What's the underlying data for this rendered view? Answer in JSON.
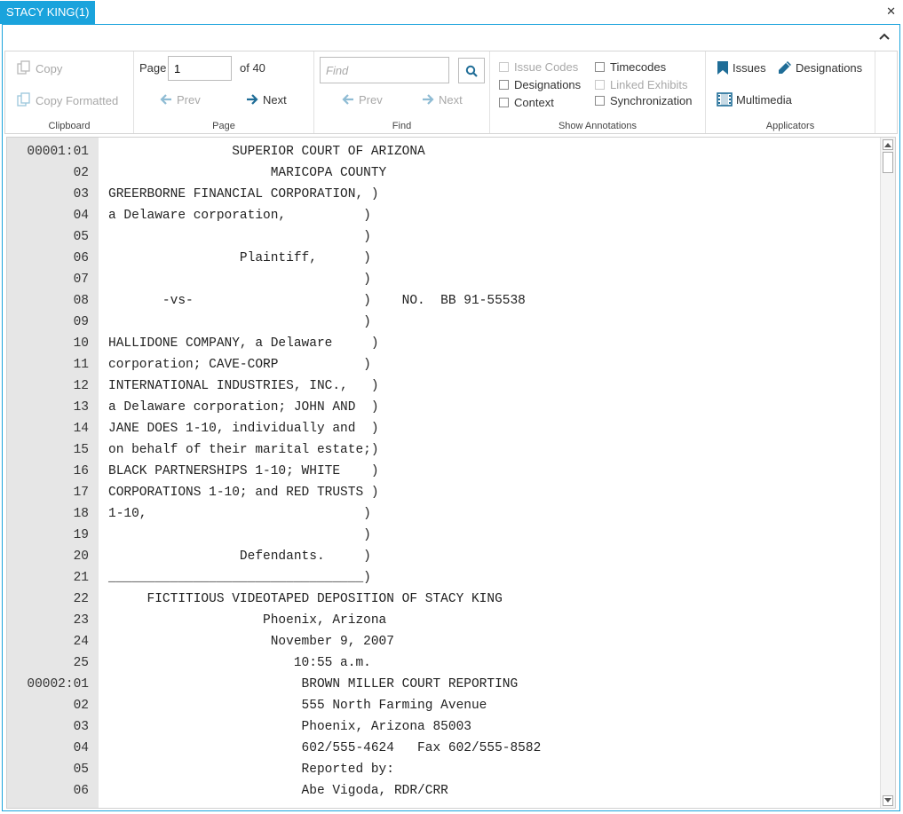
{
  "tab": {
    "title": "STACY KING(1)"
  },
  "ribbon": {
    "clipboard": {
      "copy": "Copy",
      "copy_formatted": "Copy Formatted",
      "label": "Clipboard"
    },
    "page": {
      "label_page": "Page",
      "current": "1",
      "of_total": "of 40",
      "prev": "Prev",
      "next": "Next",
      "label": "Page"
    },
    "find": {
      "placeholder": "Find",
      "prev": "Prev",
      "next": "Next",
      "label": "Find"
    },
    "annotations": {
      "issue_codes": "Issue Codes",
      "designations": "Designations",
      "context": "Context",
      "timecodes": "Timecodes",
      "linked_exhibits": "Linked Exhibits",
      "synchronization": "Synchronization",
      "label": "Show Annotations"
    },
    "applicators": {
      "issues": "Issues",
      "designations": "Designations",
      "multimedia": "Multimedia",
      "label": "Applicators"
    }
  },
  "colors": {
    "accent": "#1aa3dc",
    "icon_blue": "#1f6d97",
    "disabled": "#a8a8a8"
  },
  "transcript": [
    {
      "num": "00001:01",
      "text": "                SUPERIOR COURT OF ARIZONA"
    },
    {
      "num": "02",
      "text": "                     MARICOPA COUNTY"
    },
    {
      "num": "03",
      "text": "GREERBORNE FINANCIAL CORPORATION, )"
    },
    {
      "num": "04",
      "text": "a Delaware corporation,          )"
    },
    {
      "num": "05",
      "text": "                                 )"
    },
    {
      "num": "06",
      "text": "                 Plaintiff,      )"
    },
    {
      "num": "07",
      "text": "                                 )"
    },
    {
      "num": "08",
      "text": "       -vs-                      )    NO.  BB 91-55538"
    },
    {
      "num": "09",
      "text": "                                 )"
    },
    {
      "num": "10",
      "text": "HALLIDONE COMPANY, a Delaware     )"
    },
    {
      "num": "11",
      "text": "corporation; CAVE-CORP           )"
    },
    {
      "num": "12",
      "text": "INTERNATIONAL INDUSTRIES, INC.,   )"
    },
    {
      "num": "13",
      "text": "a Delaware corporation; JOHN AND  )"
    },
    {
      "num": "14",
      "text": "JANE DOES 1-10, individually and  )"
    },
    {
      "num": "15",
      "text": "on behalf of their marital estate;)"
    },
    {
      "num": "16",
      "text": "BLACK PARTNERSHIPS 1-10; WHITE    )"
    },
    {
      "num": "17",
      "text": "CORPORATIONS 1-10; and RED TRUSTS )"
    },
    {
      "num": "18",
      "text": "1-10,                            )"
    },
    {
      "num": "19",
      "text": "                                 )"
    },
    {
      "num": "20",
      "text": "                 Defendants.     )"
    },
    {
      "num": "21",
      "text": "_________________________________)"
    },
    {
      "num": "22",
      "text": "     FICTITIOUS VIDEOTAPED DEPOSITION OF STACY KING"
    },
    {
      "num": "23",
      "text": "                    Phoenix, Arizona"
    },
    {
      "num": "24",
      "text": "                     November 9, 2007"
    },
    {
      "num": "25",
      "text": "                        10:55 a.m."
    },
    {
      "num": "00002:01",
      "text": "                         BROWN MILLER COURT REPORTING"
    },
    {
      "num": "02",
      "text": "                         555 North Farming Avenue"
    },
    {
      "num": "03",
      "text": "                         Phoenix, Arizona 85003"
    },
    {
      "num": "04",
      "text": "                         602/555-4624   Fax 602/555-8582"
    },
    {
      "num": "05",
      "text": "                         Reported by:"
    },
    {
      "num": "06",
      "text": "                         Abe Vigoda, RDR/CRR"
    }
  ]
}
